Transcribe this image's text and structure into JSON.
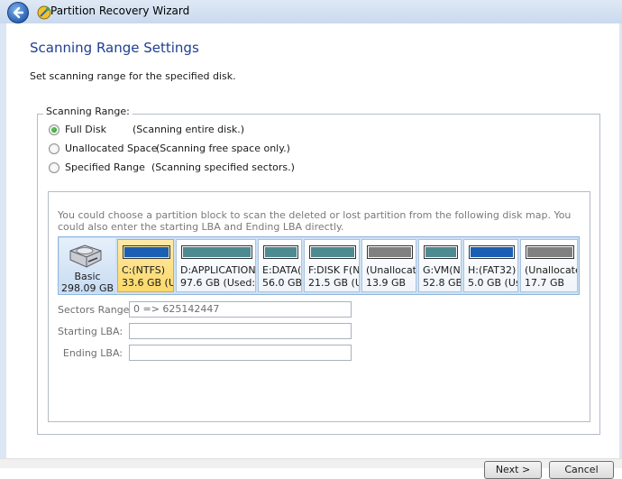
{
  "window": {
    "title": "Partition Recovery Wizard"
  },
  "page": {
    "title": "Scanning Range Settings",
    "description": "Set scanning range for the specified disk."
  },
  "scanning_range": {
    "group_label": "Scanning Range:",
    "options": [
      {
        "label": "Full Disk",
        "description": "(Scanning entire disk.)",
        "checked": true
      },
      {
        "label": "Unallocated Space",
        "description": "(Scanning free space only.)",
        "checked": false
      },
      {
        "label": "Specified Range",
        "description": "(Scanning specified sectors.)",
        "checked": false
      }
    ]
  },
  "disk_map": {
    "info": "You could choose a partition block to scan the deleted or lost partition from the following disk map. You could also enter the starting LBA and Ending LBA directly.",
    "disk": {
      "type": "Basic",
      "size": "298.09 GB"
    },
    "partitions": [
      {
        "name": "C:(NTFS)",
        "detail": "33.6 GB (U",
        "color": "#1a5fb4",
        "selected": true
      },
      {
        "name": "D:APPLICATION",
        "detail": "97.6 GB (Used: 8",
        "color": "#4e8a91",
        "selected": false
      },
      {
        "name": "E:DATA(",
        "detail": "56.0 GB",
        "color": "#4e8a91",
        "selected": false
      },
      {
        "name": "F:DISK F(N",
        "detail": "21.5 GB (U",
        "color": "#4e8a91",
        "selected": false
      },
      {
        "name": "(Unallocate",
        "detail": "13.9 GB",
        "color": "#808080",
        "selected": false
      },
      {
        "name": "G:VM(N",
        "detail": "52.8 GB",
        "color": "#4e8a91",
        "selected": false
      },
      {
        "name": "H:(FAT32)",
        "detail": "5.0 GB (Use",
        "color": "#1a5fb4",
        "selected": false
      },
      {
        "name": "(Unallocate",
        "detail": "17.7 GB",
        "color": "#808080",
        "selected": false
      }
    ]
  },
  "sectors": {
    "range_label": "Sectors Range:",
    "range_value": "0 => 625142447",
    "start_label": "Starting LBA:",
    "start_value": "",
    "end_label": "Ending LBA:",
    "end_value": ""
  },
  "buttons": {
    "next": "Next >",
    "cancel": "Cancel"
  }
}
